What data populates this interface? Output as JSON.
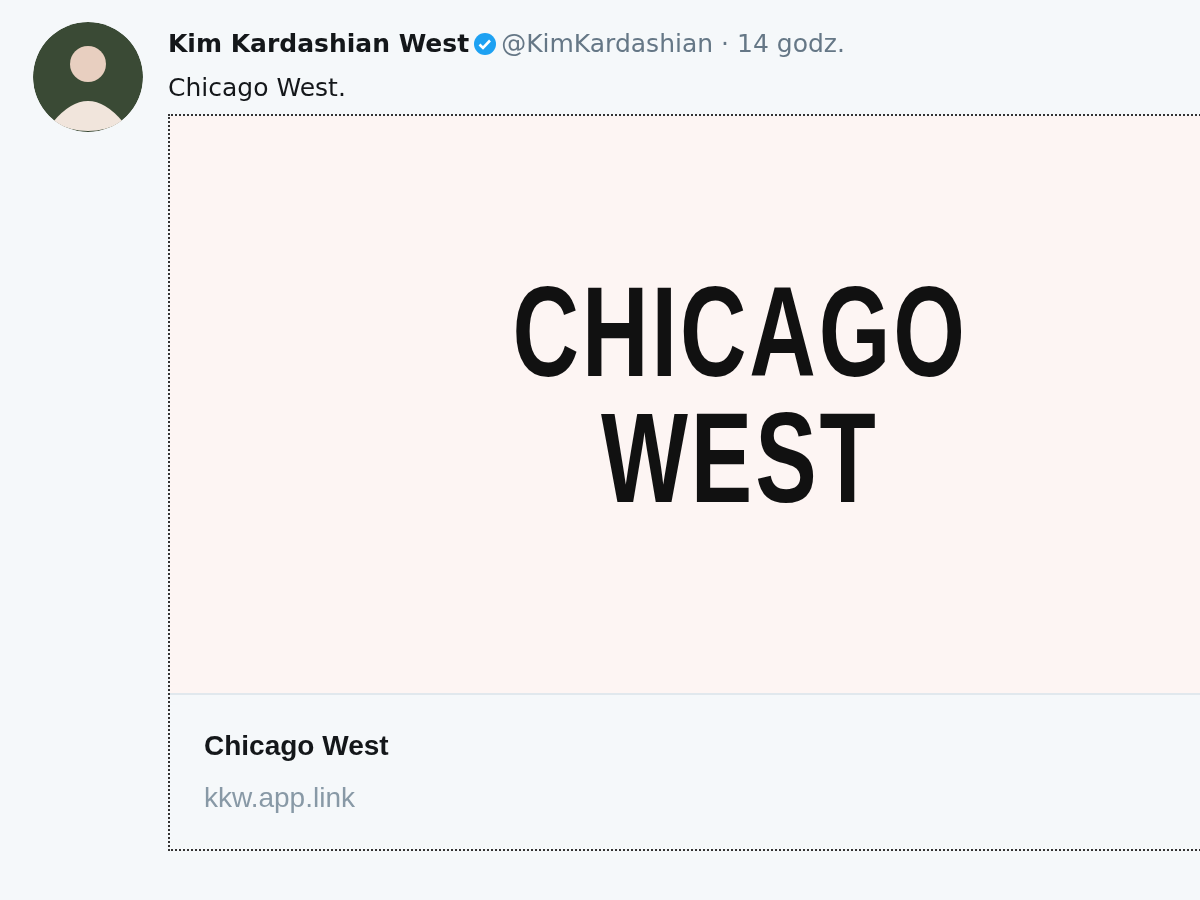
{
  "tweet": {
    "author": {
      "name": "Kim Kardashian West",
      "verified": true,
      "handle": "@KimKardashian",
      "time": "· 14 godz."
    },
    "text": "Chicago West.",
    "card": {
      "image_lines": [
        "CHICAGO",
        "WEST"
      ],
      "title": "Chicago West",
      "domain": "kkw.app.link"
    }
  }
}
